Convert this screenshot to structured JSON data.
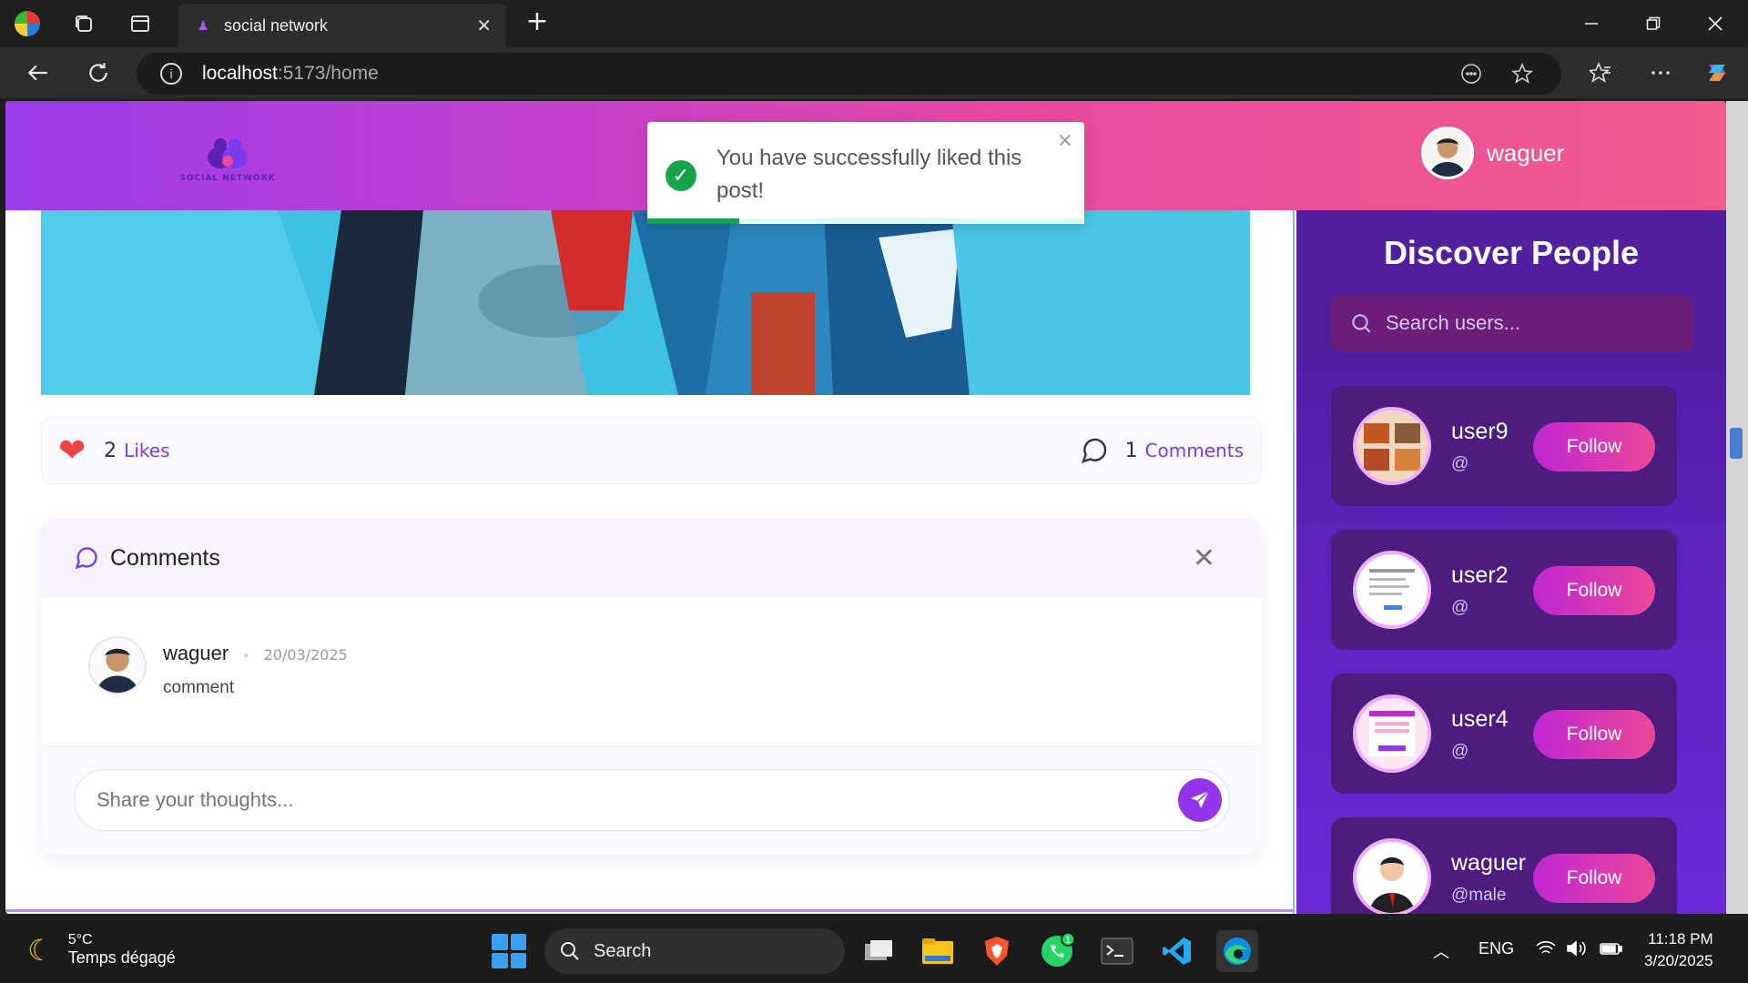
{
  "browser": {
    "tab_title": "social network",
    "url_host": "localhost",
    "url_path": ":5173/home"
  },
  "header": {
    "logo_text": "SOCIAL NETWORK",
    "profile_name": "waguer"
  },
  "toast": {
    "message": "You have successfully liked this post!",
    "close": "×",
    "progress": 0.21
  },
  "post": {
    "likes_count": "2",
    "likes_label": "Likes",
    "comments_count": "1",
    "comments_label": "Comments"
  },
  "comments_panel": {
    "title": "Comments",
    "close": "✕",
    "items": [
      {
        "author": "waguer",
        "date": "20/03/2025",
        "text": "comment"
      }
    ],
    "input_placeholder": "Share your thoughts..."
  },
  "sidebar": {
    "title": "Discover People",
    "search_placeholder": "Search users...",
    "follow_label": "Follow",
    "users": [
      {
        "name": "user9",
        "handle": "@"
      },
      {
        "name": "user2",
        "handle": "@"
      },
      {
        "name": "user4",
        "handle": "@"
      },
      {
        "name": "waguer",
        "handle": "@male"
      }
    ]
  },
  "taskbar": {
    "temp": "5°C",
    "weather": "Temps dégagé",
    "search": "Search",
    "lang": "ENG",
    "time": "11:18 PM",
    "date": "3/20/2025",
    "whatsapp_badge": "1"
  },
  "colors": {
    "accent": "#7c3aed",
    "header_start": "#9b3dea",
    "header_end": "#f05a8e",
    "success": "#16a34a"
  }
}
